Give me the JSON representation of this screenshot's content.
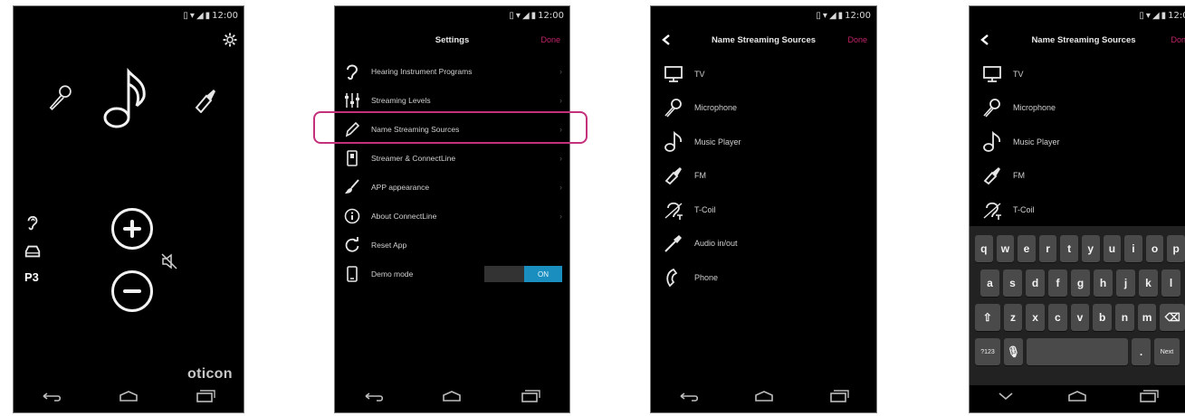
{
  "status_bar": {
    "time": "12:00"
  },
  "home": {
    "program": "P3",
    "brand": "oticon",
    "icons": [
      "gear-icon",
      "microphone-icon",
      "music-note-icon",
      "fm-icon",
      "ear-icon",
      "car-icon",
      "mute-icon",
      "volume-up-icon",
      "volume-down-icon"
    ]
  },
  "settings": {
    "title": "Settings",
    "done": "Done",
    "items": [
      {
        "label": "Hearing Instrument Programs",
        "icon": "ear-icon"
      },
      {
        "label": "Streaming Levels",
        "icon": "sliders-icon"
      },
      {
        "label": "Name Streaming Sources",
        "icon": "pencil-icon",
        "highlighted": true
      },
      {
        "label": "Streamer & ConnectLine",
        "icon": "streamer-icon"
      },
      {
        "label": "APP appearance",
        "icon": "brush-icon"
      },
      {
        "label": "About ConnectLine",
        "icon": "info-icon"
      },
      {
        "label": "Reset App",
        "icon": "reset-icon"
      },
      {
        "label": "Demo mode",
        "icon": "phone-icon",
        "toggle": "ON"
      }
    ]
  },
  "sources": {
    "title": "Name Streaming Sources",
    "done": "Done",
    "items": [
      {
        "label": "TV",
        "icon": "tv-icon"
      },
      {
        "label": "Microphone",
        "icon": "microphone-icon"
      },
      {
        "label": "Music Player",
        "icon": "music-note-icon"
      },
      {
        "label": "FM",
        "icon": "fm-icon"
      },
      {
        "label": "T-Coil",
        "icon": "tcoil-icon"
      },
      {
        "label": "Audio in/out",
        "icon": "audio-jack-icon"
      },
      {
        "label": "Phone",
        "icon": "phone-handset-icon"
      }
    ]
  },
  "sources_edit": {
    "title": "Name Streaming Sources",
    "done": "Done",
    "items": [
      {
        "label": "TV"
      },
      {
        "label": "Microphone"
      },
      {
        "label": "Music Player"
      },
      {
        "label": "FM"
      },
      {
        "label": "T-Coil"
      }
    ],
    "keyboard": {
      "row1": [
        "q",
        "w",
        "e",
        "r",
        "t",
        "y",
        "u",
        "i",
        "o",
        "p"
      ],
      "row2": [
        "a",
        "s",
        "d",
        "f",
        "g",
        "h",
        "j",
        "k",
        "l"
      ],
      "row3": [
        "z",
        "x",
        "c",
        "v",
        "b",
        "n",
        "m"
      ],
      "symbols": "?123",
      "period": ".",
      "next": "Next"
    }
  },
  "colors": {
    "accent": "#c5307a",
    "toggle_on": "#1a8fbf",
    "background": "#000000"
  }
}
